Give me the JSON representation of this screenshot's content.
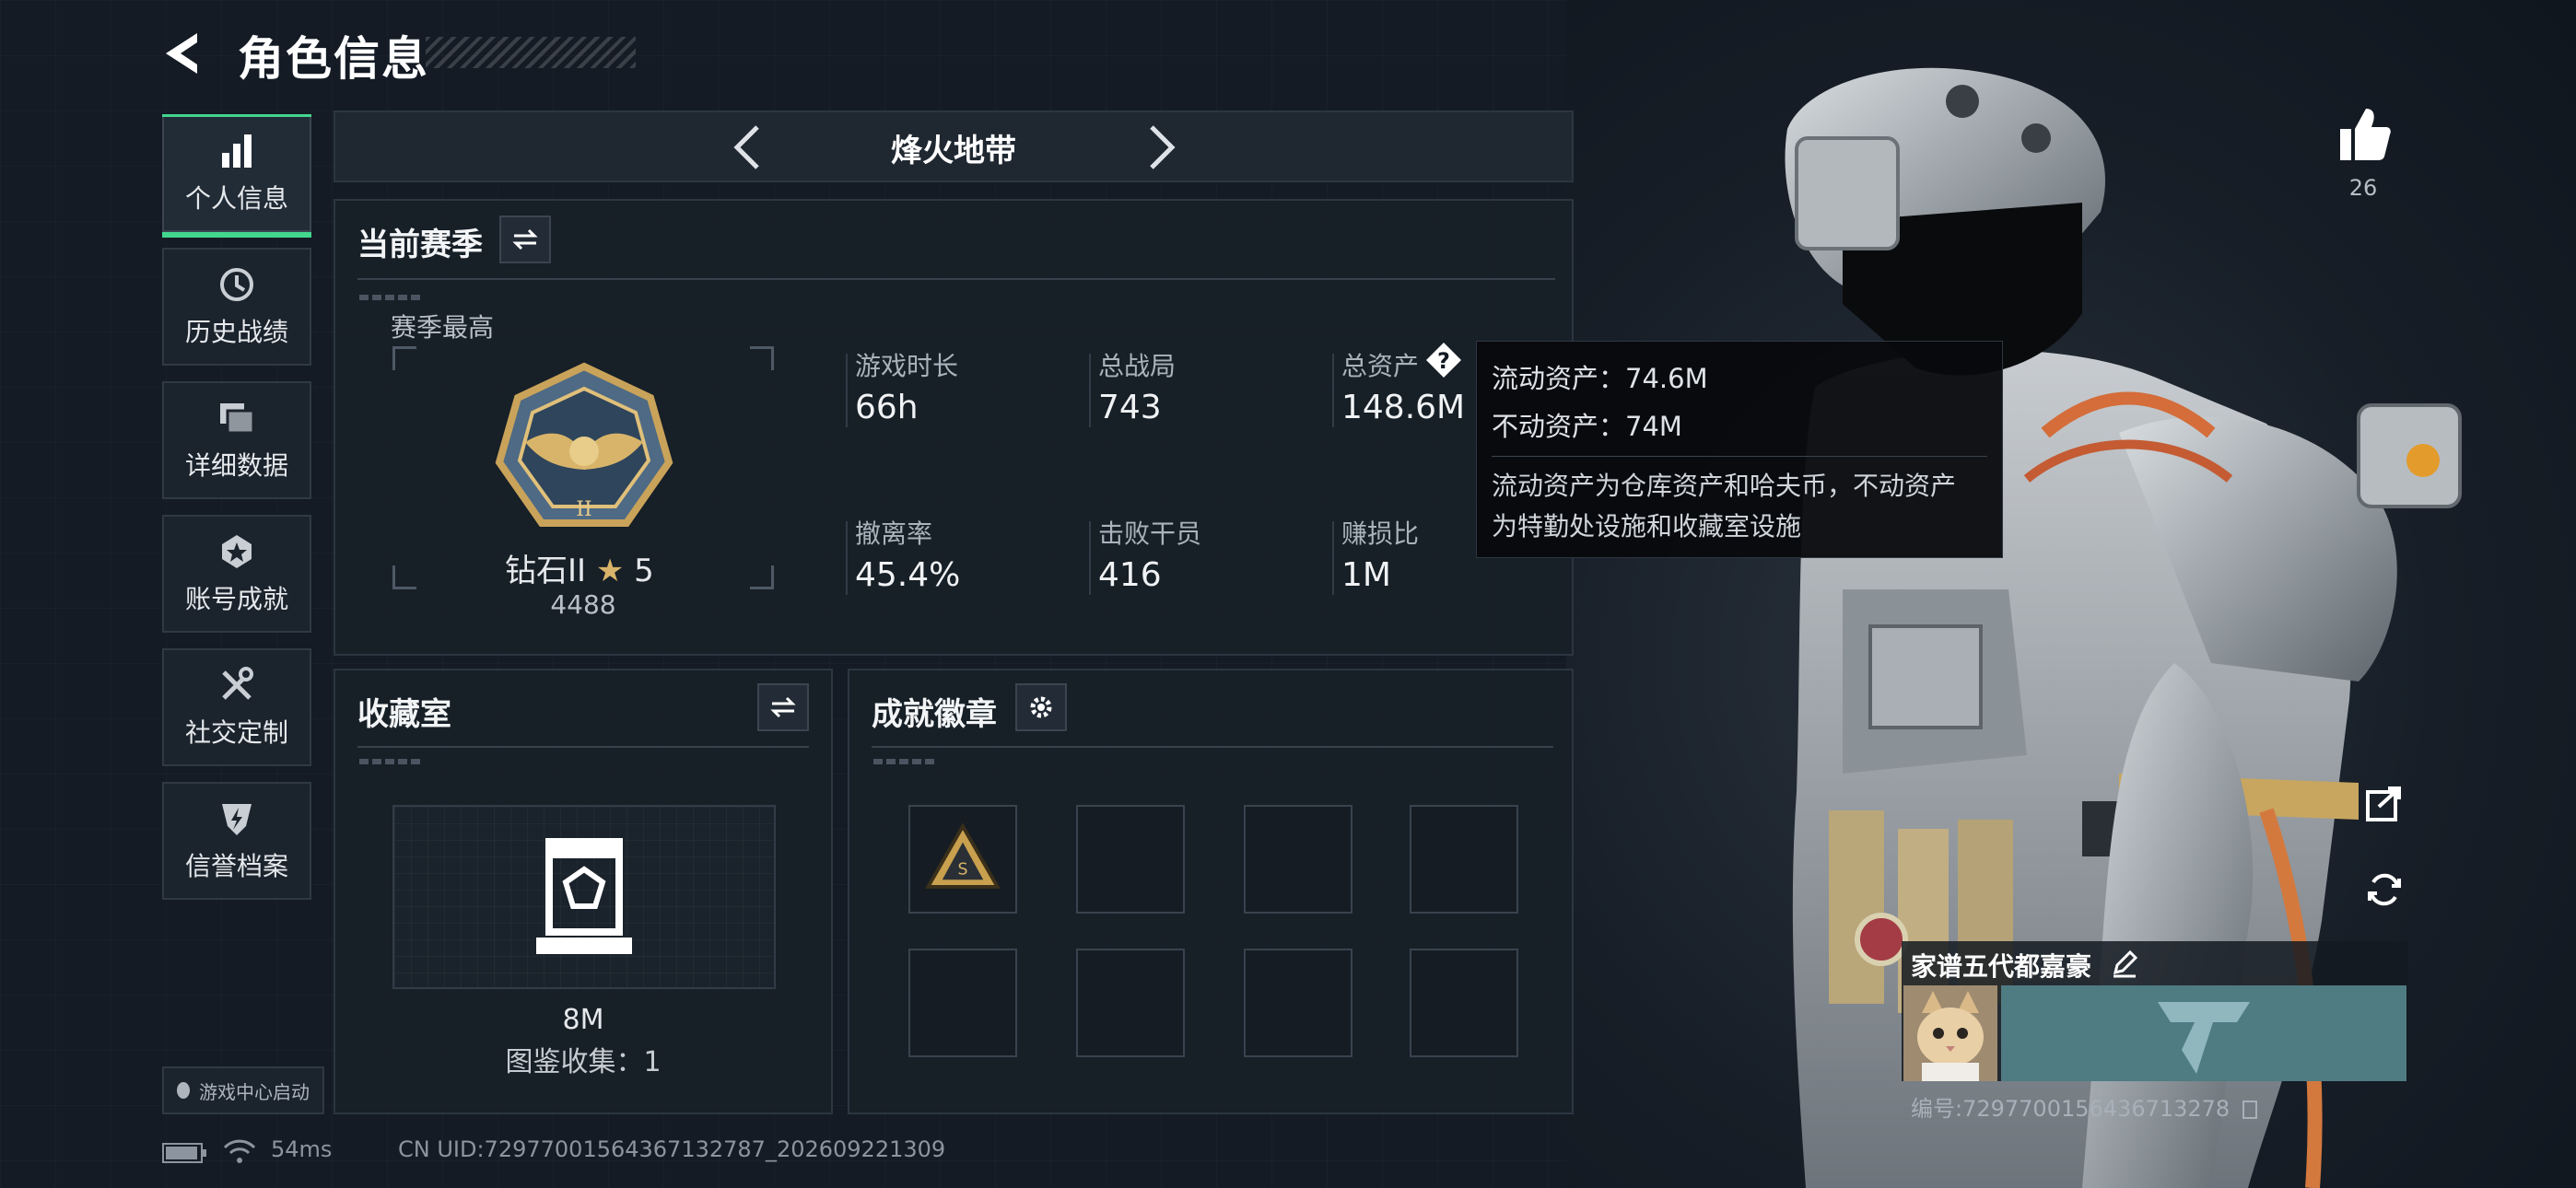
{
  "header": {
    "title": "角色信息"
  },
  "nav": {
    "items": [
      {
        "label": "个人信息",
        "icon": "bar-chart-icon",
        "active": true
      },
      {
        "label": "历史战绩",
        "icon": "history-icon"
      },
      {
        "label": "详细数据",
        "icon": "files-icon"
      },
      {
        "label": "账号成就",
        "icon": "achievement-icon"
      },
      {
        "label": "社交定制",
        "icon": "tools-icon"
      },
      {
        "label": "信誉档案",
        "icon": "shield-bolt-icon"
      }
    ],
    "game_center": "游戏中心启动"
  },
  "mode": {
    "name": "烽火地带"
  },
  "season": {
    "title": "当前赛季",
    "best_label": "赛季最高",
    "rank_name": "钻石II",
    "rank_stars": "5",
    "rank_score": "4488",
    "stats": [
      {
        "label": "游戏时长",
        "value": "66h"
      },
      {
        "label": "总战局",
        "value": "743"
      },
      {
        "label": "总资产",
        "value": "148.6M"
      },
      {
        "label": "撤离率",
        "value": "45.4%"
      },
      {
        "label": "击败干员",
        "value": "416"
      },
      {
        "label": "赚损比",
        "value": "1M"
      }
    ]
  },
  "tooltip": {
    "liquid": "流动资产：74.6M",
    "fixed": "不动资产：74M",
    "desc_line1": "流动资产为仓库资产和哈夫币，不动资产",
    "desc_line2": "为特勤处设施和收藏室设施"
  },
  "collection": {
    "title": "收藏室",
    "value": "8M",
    "count_label": "图鉴收集：1"
  },
  "badges": {
    "title": "成就徽章",
    "slots_filled": 1,
    "slots_total": 8
  },
  "player": {
    "likes": "26",
    "name": "家谱五代都嘉豪",
    "id_label": "编号:7297700156436713278"
  },
  "status": {
    "ping": "54ms",
    "uid": "CN UID:7297700156436713278​7_202609221309"
  },
  "colors": {
    "accent": "#43d68f",
    "panel": "#181f28",
    "background": "#141b24"
  }
}
